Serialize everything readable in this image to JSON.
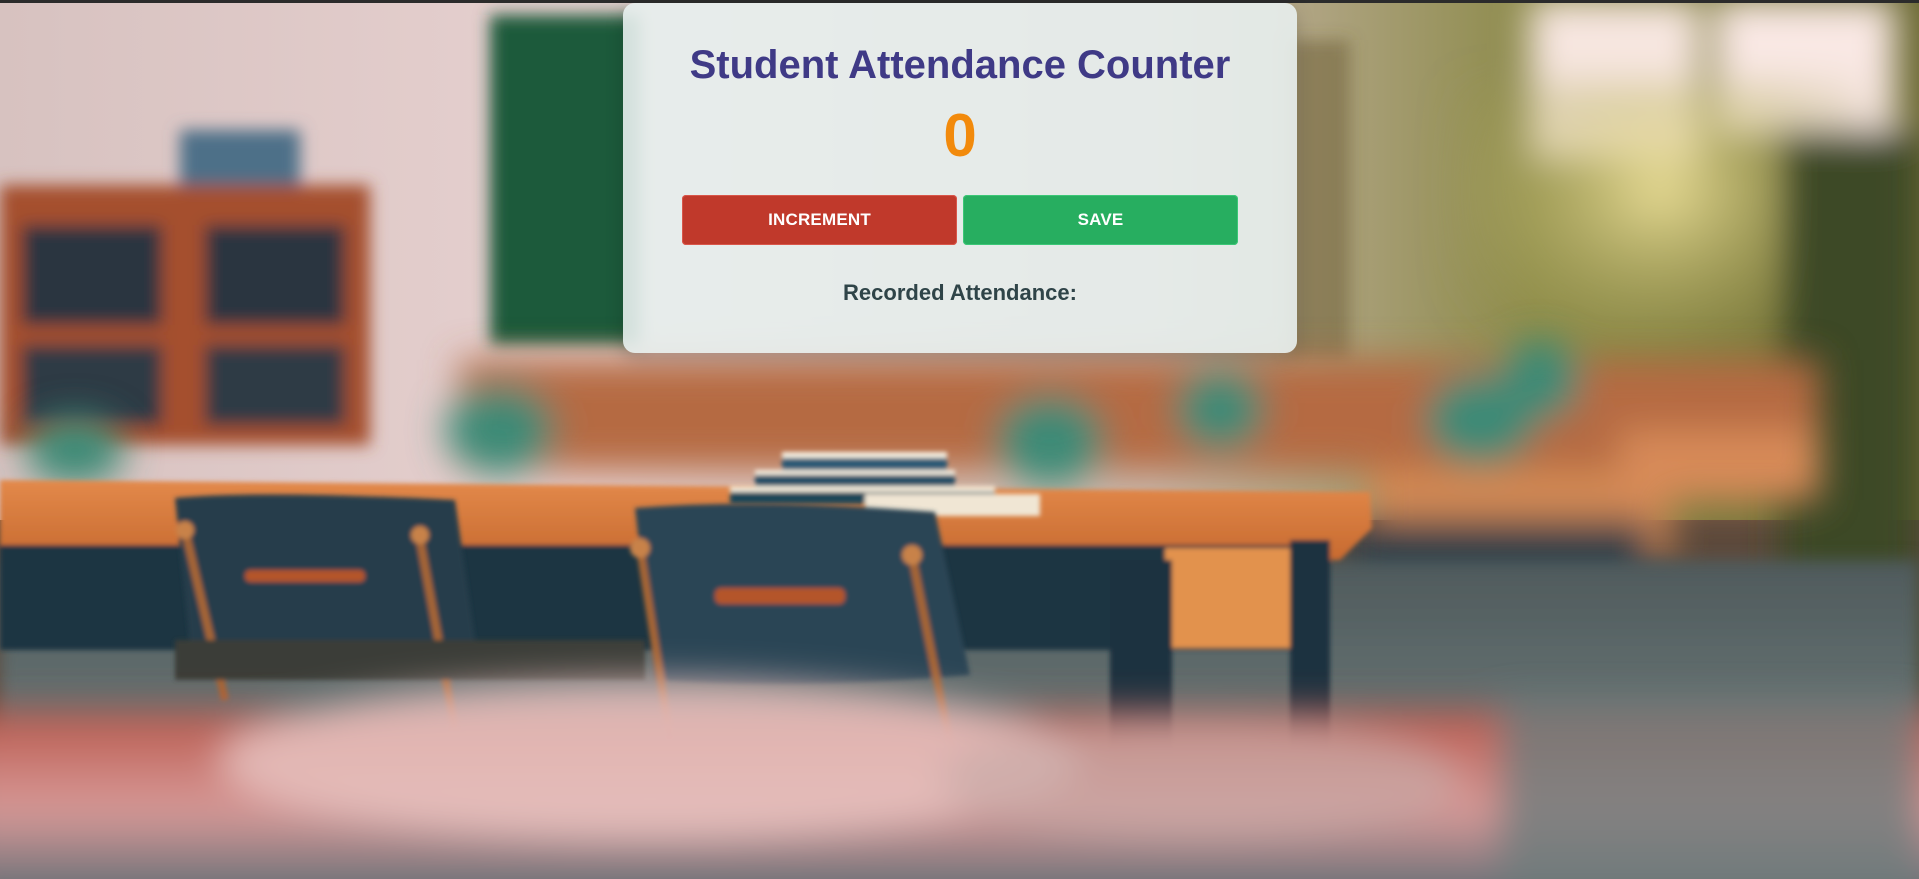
{
  "app": {
    "title": "Student Attendance Counter",
    "count": "0",
    "increment_label": "INCREMENT",
    "save_label": "SAVE",
    "recorded_label": "Recorded Attendance:"
  },
  "background": {
    "description_name": "classroom-background-image"
  },
  "colors": {
    "title": "#3f3a86",
    "count": "#f28a0c",
    "increment_button": "#c0392b",
    "save_button": "#27ae60",
    "recorded_text": "#2f4448"
  }
}
